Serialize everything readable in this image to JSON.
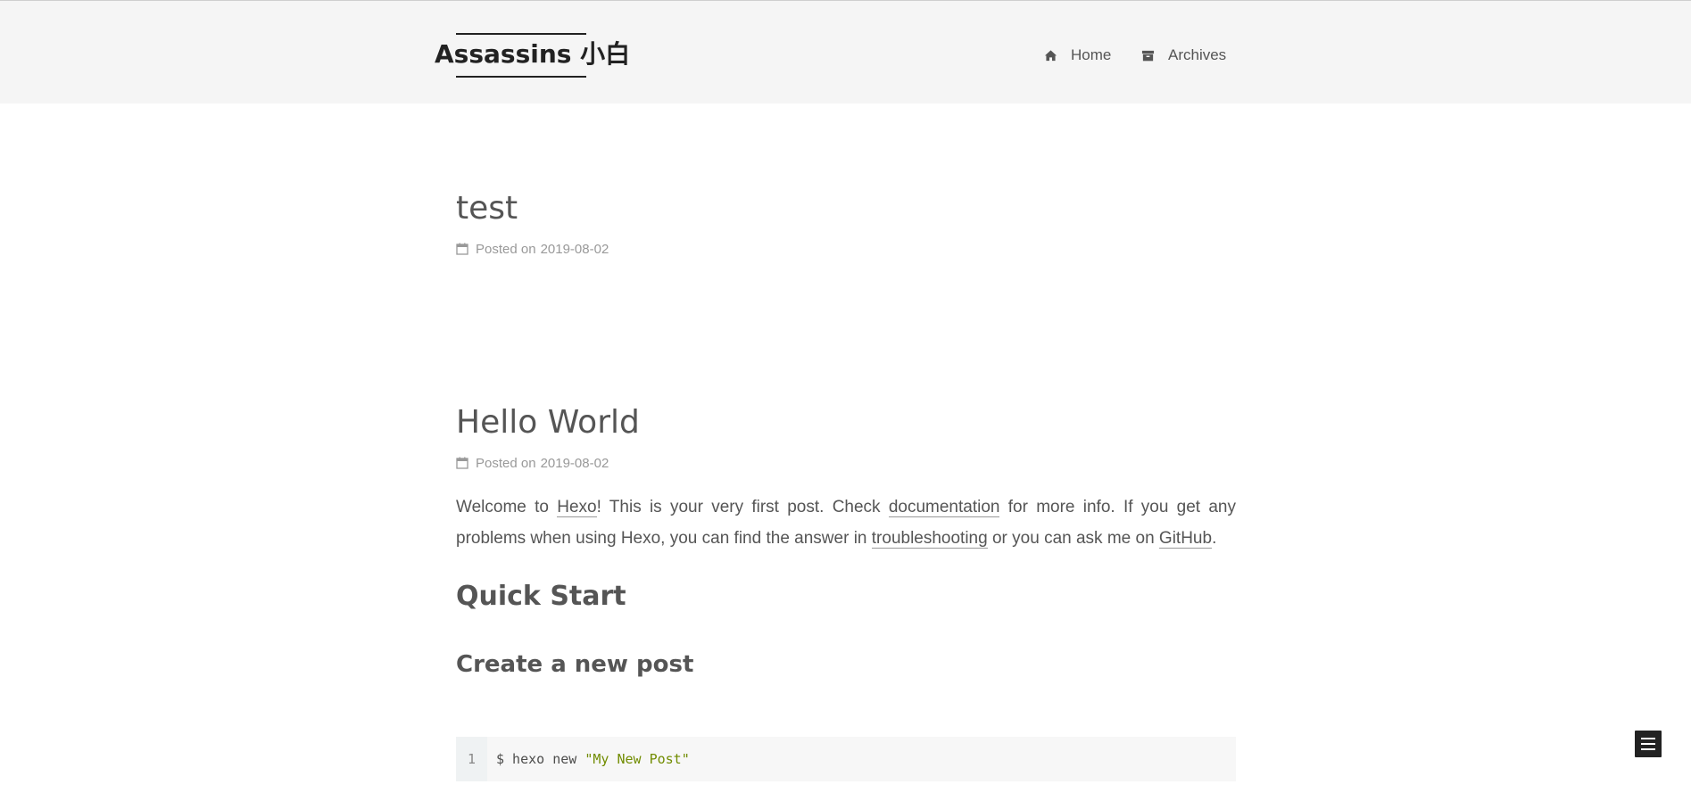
{
  "site": {
    "title": "Assassins 小白"
  },
  "nav": {
    "items": [
      {
        "label": "Home",
        "icon": "home-icon"
      },
      {
        "label": "Archives",
        "icon": "archive-icon"
      }
    ]
  },
  "posts": [
    {
      "title": "test",
      "meta_prefix": "Posted on",
      "date": "2019-08-02"
    },
    {
      "title": "Hello World",
      "meta_prefix": "Posted on",
      "date": "2019-08-02",
      "body": {
        "p1_t1": "Welcome to ",
        "p1_link_hexo": "Hexo",
        "p1_t2": "! This is your very first post. Check ",
        "p1_link_docs": "documentation",
        "p1_t3": " for more info. If you get any problems when using Hexo, you can find the answer in ",
        "p1_link_troubleshooting": "troubleshooting",
        "p1_t4": " or you can ask me on ",
        "p1_link_github": "GitHub",
        "p1_t5": ".",
        "h2_quick_start": "Quick Start",
        "h3_create_post": "Create a new post"
      },
      "code": {
        "line_number": "1",
        "command": "$ hexo new ",
        "argument": "\"My New Post\""
      }
    }
  ],
  "colors": {
    "header_bg": "#f5f5f5",
    "text": "#555555",
    "meta": "#999999",
    "code_bg": "#f7f7f7",
    "code_string": "#718c00",
    "toggle_bg": "#222222"
  }
}
